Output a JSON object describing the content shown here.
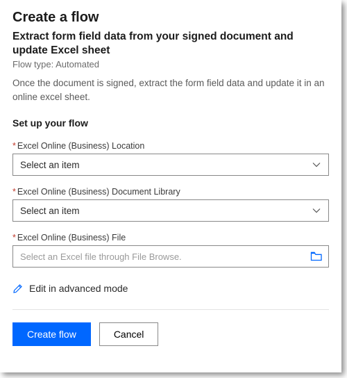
{
  "title": "Create a flow",
  "subtitle": "Extract form field data from your signed document and update Excel sheet",
  "flow_type": "Flow type: Automated",
  "description": "Once the document is signed, extract the form field data and update it in an online excel sheet.",
  "setup_heading": "Set up your flow",
  "fields": {
    "location": {
      "label": "Excel Online (Business) Location",
      "value": "Select an item"
    },
    "library": {
      "label": "Excel Online (Business) Document Library",
      "value": "Select an item"
    },
    "file": {
      "label": "Excel Online (Business) File",
      "placeholder": "Select an Excel file through File Browse."
    }
  },
  "advanced_link": "Edit in advanced mode",
  "buttons": {
    "create": "Create flow",
    "cancel": "Cancel"
  },
  "required_marker": "*",
  "colors": {
    "primary": "#0067ff",
    "required": "#c0392b"
  }
}
